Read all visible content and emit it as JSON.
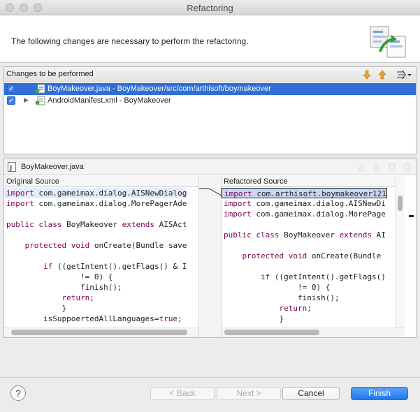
{
  "window": {
    "title": "Refactoring"
  },
  "header": {
    "message": "The following changes are necessary to perform the refactoring."
  },
  "changes": {
    "title": "Changes to be performed",
    "items": [
      {
        "label": "BoyMakeover.java - BoyMakeover/src/com/arthisoft/boymakeover",
        "checked": true,
        "selected": true
      },
      {
        "label": "AndroidManifest.xml - BoyMakeover",
        "checked": true,
        "selected": false
      }
    ]
  },
  "compare": {
    "file": "BoyMakeover.java",
    "original_title": "Original Source",
    "refactored_title": "Refactored Source",
    "original_lines": [
      "import com.gameimax.dialog.AISNewDialog",
      "import com.gameimax.dialog.MorePagerAde",
      "",
      "public class BoyMakeover extends AISAct",
      "",
      "    protected void onCreate(Bundle save",
      "",
      "        if ((getIntent().getFlags() & I",
      "                != 0) {",
      "                finish();",
      "            return;",
      "            }",
      "        isSuppoertedAllLanguages=true;"
    ],
    "refactored_lines": [
      "import com.arthisoft.boymakeover121",
      "import com.gameimax.dialog.AISNewDi",
      "import com.gameimax.dialog.MorePage",
      "",
      "public class BoyMakeover extends AI",
      "",
      "    protected void onCreate(Bundle",
      "",
      "        if ((getIntent().getFlags()",
      "                != 0) {",
      "                finish();",
      "            return;",
      "            }"
    ]
  },
  "buttons": {
    "help": "?",
    "back": "< Back",
    "next": "Next >",
    "cancel": "Cancel",
    "finish": "Finish"
  }
}
